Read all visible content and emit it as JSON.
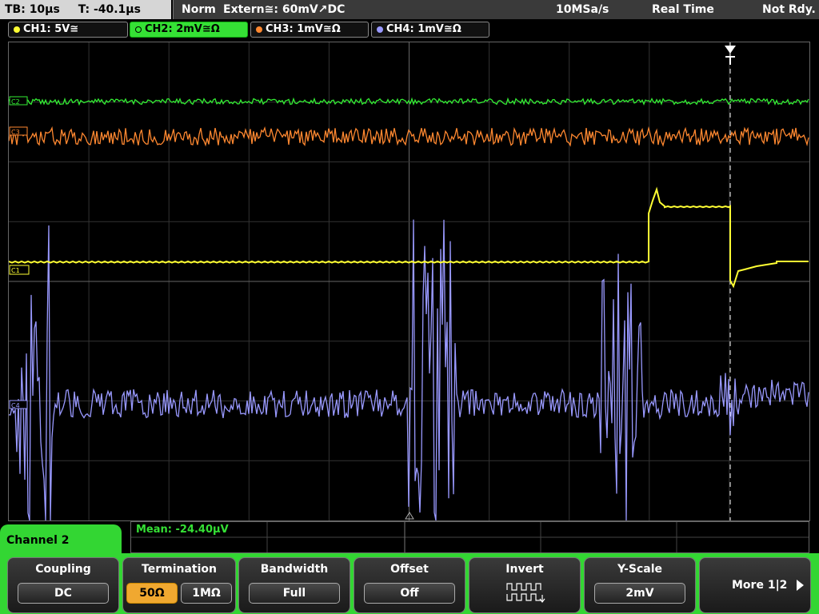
{
  "topbar": {
    "timebase": "TB: 10µs",
    "trigger_time": "T: -40.1µs",
    "mode": "Norm",
    "trigger": "Extern≅: 60mV↗DC",
    "sample_rate": "10MSa/s",
    "acq_mode": "Real Time",
    "status": "Not Rdy."
  },
  "channels": [
    {
      "label": "CH1: 5V≅",
      "color": "#ffff33",
      "active": false
    },
    {
      "label": "CH2: 2mV≅Ω",
      "color": "#33ee33",
      "active": true
    },
    {
      "label": "CH3: 1mV≅Ω",
      "color": "#ff8830",
      "active": false
    },
    {
      "label": "CH4: 1mV≅Ω",
      "color": "#9999ff",
      "active": false
    }
  ],
  "trace_markers": {
    "c1": "C1",
    "c2": "C2",
    "c3": "C3",
    "c4": "C4"
  },
  "measurement": {
    "mean": "Mean: -24.40µV"
  },
  "panel": {
    "title": "Channel 2",
    "coupling": {
      "title": "Coupling",
      "value": "DC"
    },
    "termination": {
      "title": "Termination",
      "opt1": "50Ω",
      "opt2": "1MΩ"
    },
    "bandwidth": {
      "title": "Bandwidth",
      "value": "Full"
    },
    "offset": {
      "title": "Offset",
      "value": "Off"
    },
    "invert": {
      "title": "Invert"
    },
    "yscale": {
      "title": "Y-Scale",
      "value": "2mV"
    },
    "more": {
      "label": "More 1|2"
    }
  },
  "colors": {
    "ch1": "#ffff33",
    "ch2": "#33ee33",
    "ch3": "#ff8830",
    "ch4": "#9999ff",
    "grid": "#444444"
  }
}
